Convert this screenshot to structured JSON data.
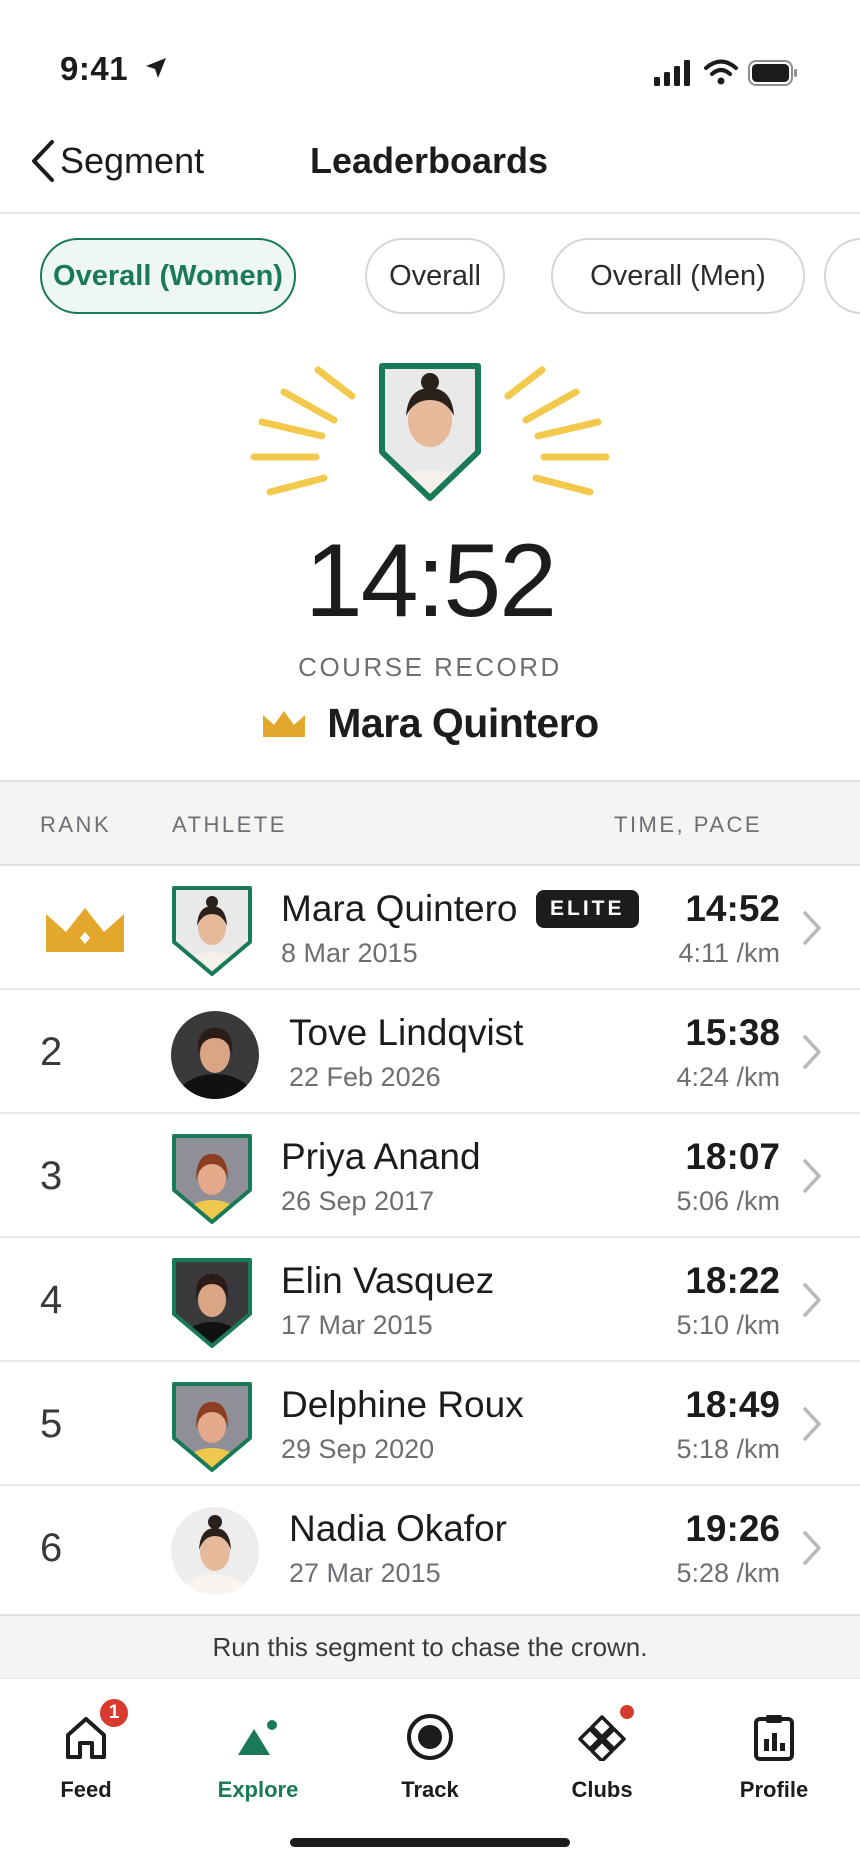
{
  "status": {
    "time": "9:41"
  },
  "nav": {
    "back_label": "Segment",
    "title": "Leaderboards"
  },
  "filters": [
    {
      "label": "Overall (Women)",
      "active": true
    },
    {
      "label": "Overall",
      "active": false
    },
    {
      "label": "Overall (Men)",
      "active": false
    }
  ],
  "hero": {
    "record_time": "14:52",
    "record_label": "COURSE RECORD",
    "holder": "Mara Quintero"
  },
  "table": {
    "headers": {
      "rank": "RANK",
      "athlete": "ATHLETE",
      "time_pace": "TIME, PACE"
    },
    "rows": [
      {
        "rank": "",
        "name": "Mara Quintero",
        "badge": "ELITE",
        "date": "8 Mar 2015",
        "time": "14:52",
        "pace": "4:11 /km"
      },
      {
        "rank": "2",
        "name": "Tove Lindqvist",
        "date": "22 Feb 2026",
        "time": "15:38",
        "pace": "4:24 /km"
      },
      {
        "rank": "3",
        "name": "Priya Anand",
        "date": "26 Sep 2017",
        "time": "18:07",
        "pace": "5:06 /km"
      },
      {
        "rank": "4",
        "name": "Elin Vasquez",
        "date": "17 Mar 2015",
        "time": "18:22",
        "pace": "5:10 /km"
      },
      {
        "rank": "5",
        "name": "Delphine Roux",
        "date": "29 Sep 2020",
        "time": "18:49",
        "pace": "5:18 /km"
      },
      {
        "rank": "6",
        "name": "Nadia Okafor",
        "date": "27 Mar 2015",
        "time": "19:26",
        "pace": "5:28 /km"
      }
    ]
  },
  "footer_note": "Run this segment to chase the crown.",
  "tabbar": {
    "feed": {
      "label": "Feed",
      "badge": "1"
    },
    "explore": {
      "label": "Explore"
    },
    "track": {
      "label": "Track"
    },
    "clubs": {
      "label": "Clubs"
    },
    "profile": {
      "label": "Profile"
    }
  },
  "colors": {
    "accent": "#1a7a58",
    "gold": "#e3a72b",
    "ray": "#f2c94c",
    "alert": "#d93a2f"
  }
}
